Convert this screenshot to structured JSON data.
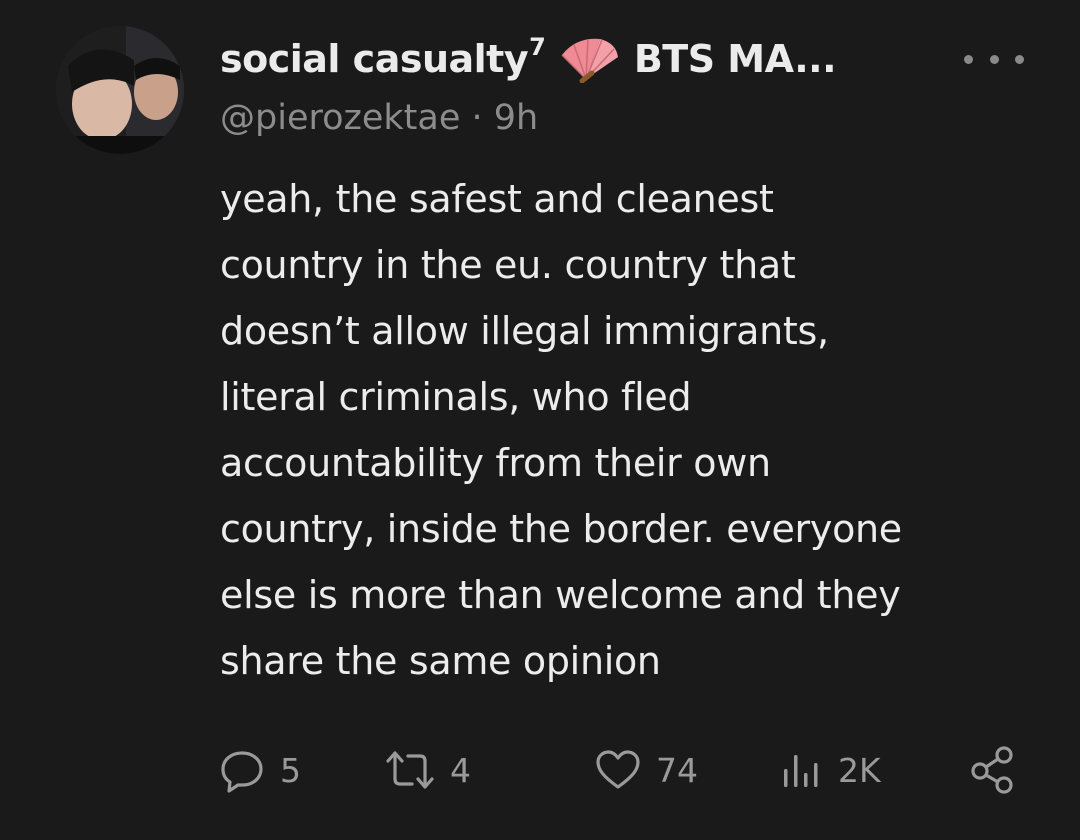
{
  "tweet": {
    "display_name": "social casualty",
    "name_superscript": "7",
    "name_suffix": "BTS MA...",
    "handle": "@pierozektae",
    "separator": " · ",
    "time": "9h",
    "body_lines": [
      "yeah, the safest and cleanest",
      "country in the eu. country that",
      "doesn’t allow illegal immigrants,",
      "literal criminals, who fled",
      "accountability from their own",
      "country, inside the border. everyone",
      "else is more than welcome and they",
      "share the same opinion"
    ],
    "actions": {
      "replies": "5",
      "reposts": "4",
      "likes": "74",
      "views": "2K"
    }
  },
  "icons": {
    "avatar": "avatar-photo",
    "name_emoji": "folding-fan-icon",
    "more": "more-options-icon",
    "reply": "reply-icon",
    "repost": "repost-icon",
    "like": "heart-icon",
    "views": "views-chart-icon",
    "share": "share-icon"
  },
  "colors": {
    "background": "#1a1a1a",
    "text_primary": "#ececec",
    "text_secondary": "#8c8c8c",
    "action_gray": "#9a9a9a",
    "fan_pink": "#f08a94",
    "fan_brown": "#8b5a2b"
  }
}
